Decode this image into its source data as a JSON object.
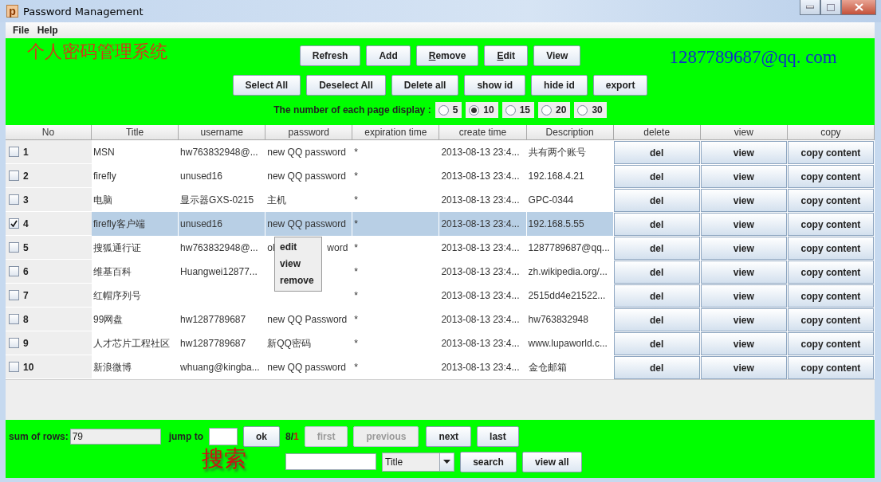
{
  "window": {
    "title": "Password Management",
    "icon_letter": "p"
  },
  "menu": [
    "File",
    "Help"
  ],
  "header": {
    "title": "个人密码管理系统",
    "email": "1287789687@qq. com"
  },
  "toolbar_rows": [
    [
      {
        "label": "Refresh",
        "underline_first": false
      },
      {
        "label": "Add",
        "underline_first": false
      },
      {
        "label": "Remove",
        "underline_first": true
      },
      {
        "label": "Edit",
        "underline_first": true
      },
      {
        "label": "View",
        "underline_first": false
      }
    ],
    [
      {
        "label": "Select All",
        "underline_first": false
      },
      {
        "label": "Deselect All",
        "underline_first": false
      },
      {
        "label": "Delete all",
        "underline_first": false
      },
      {
        "label": "show id",
        "underline_first": false
      },
      {
        "label": "hide id",
        "underline_first": false
      },
      {
        "label": "export",
        "underline_first": false
      }
    ]
  ],
  "page_size": {
    "label": "The number of each page display :",
    "options": [
      {
        "label": "5",
        "selected": false
      },
      {
        "label": "10",
        "selected": true
      },
      {
        "label": "15",
        "selected": false
      },
      {
        "label": "20",
        "selected": false
      },
      {
        "label": "30",
        "selected": false
      }
    ]
  },
  "table": {
    "columns": [
      "No",
      "Title",
      "username",
      "password",
      "expiration time",
      "create time",
      "Description",
      "delete",
      "view",
      "copy"
    ],
    "rows": [
      {
        "no": "1",
        "checked": false,
        "selected": false,
        "title": "MSN",
        "username": "hw763832948@...",
        "password": "new QQ password",
        "expiration": "*",
        "create_time": "2013-08-13 23:4...",
        "description": "共有两个账号",
        "actions": [
          "del",
          "view",
          "copy content"
        ]
      },
      {
        "no": "2",
        "checked": false,
        "selected": false,
        "title": "firefly",
        "username": "unused16",
        "password": "new QQ password",
        "expiration": "*",
        "create_time": "2013-08-13 23:4...",
        "description": "192.168.4.21",
        "actions": [
          "del",
          "view",
          "copy content"
        ]
      },
      {
        "no": "3",
        "checked": false,
        "selected": false,
        "title": "电脑",
        "username": "显示器GXS-0215",
        "password": "主机",
        "expiration": "*",
        "create_time": "2013-08-13 23:4...",
        "description": "GPC-0344",
        "actions": [
          "del",
          "view",
          "copy content"
        ]
      },
      {
        "no": "4",
        "checked": true,
        "selected": true,
        "title": "firefly客户端",
        "username": "unused16",
        "password": "new QQ password",
        "expiration": "*",
        "create_time": "2013-08-13 23:4...",
        "description": "192.168.5.55",
        "actions": [
          "del",
          "view",
          "copy content"
        ]
      },
      {
        "no": "5",
        "checked": false,
        "selected": false,
        "title": "搜狐通行证",
        "username": "hw763832948@...",
        "password_parts": [
          "ol",
          "word"
        ],
        "expiration": "*",
        "create_time": "2013-08-13 23:4...",
        "description": "1287789687@qq...",
        "actions": [
          "del",
          "view",
          "copy content"
        ]
      },
      {
        "no": "6",
        "checked": false,
        "selected": false,
        "title": "维基百科",
        "username": "Huangwei12877...",
        "expiration": "*",
        "create_time": "2013-08-13 23:4...",
        "description": "zh.wikipedia.org/...",
        "actions": [
          "del",
          "view",
          "copy content"
        ]
      },
      {
        "no": "7",
        "checked": false,
        "selected": false,
        "title": "红帽序列号",
        "expiration": "*",
        "create_time": "2013-08-13 23:4...",
        "description": "2515dd4e21522...",
        "actions": [
          "del",
          "view",
          "copy content"
        ]
      },
      {
        "no": "8",
        "checked": false,
        "selected": false,
        "title": "99网盘",
        "username": "hw1287789687",
        "password": "new QQ Password",
        "expiration": "*",
        "create_time": "2013-08-13 23:4...",
        "description": "hw763832948",
        "actions": [
          "del",
          "view",
          "copy content"
        ]
      },
      {
        "no": "9",
        "checked": false,
        "selected": false,
        "title": "人才芯片工程社区",
        "username": "hw1287789687",
        "password": "新QQ密码",
        "expiration": "*",
        "create_time": "2013-08-13 23:4...",
        "description": "www.lupaworld.c...",
        "actions": [
          "del",
          "view",
          "copy content"
        ]
      },
      {
        "no": "10",
        "checked": false,
        "selected": false,
        "title": "新浪微博",
        "username": "whuang@kingba...",
        "password": "new QQ password",
        "expiration": "*",
        "create_time": "2013-08-13 23:4...",
        "description": "金仓邮箱",
        "actions": [
          "del",
          "view",
          "copy content"
        ]
      }
    ]
  },
  "context_menu": [
    "edit",
    "view",
    "remove"
  ],
  "footer": {
    "sum_label": "sum of rows:",
    "sum_value": "79",
    "jump_label": "jump to",
    "ok": "ok",
    "page_current": "8/",
    "page_total": "1",
    "nav": [
      {
        "label": "first",
        "disabled": true
      },
      {
        "label": "previous",
        "disabled": true
      },
      {
        "label": "next",
        "disabled": false
      },
      {
        "label": "last",
        "disabled": false
      }
    ],
    "search_title": "搜索",
    "combo_value": "Title",
    "buttons": [
      "search",
      "view all"
    ]
  }
}
